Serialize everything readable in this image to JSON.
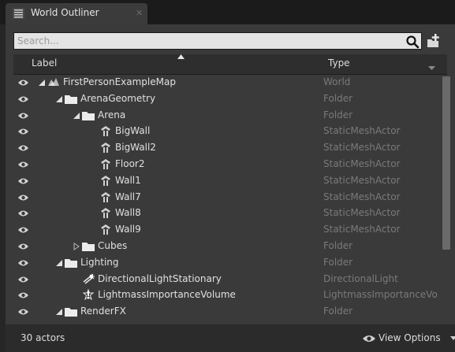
{
  "window": {
    "tab_title": "World Outliner"
  },
  "search": {
    "placeholder": "Search..."
  },
  "columns": {
    "label": "Label",
    "type": "Type"
  },
  "rows": [
    {
      "label": "FirstPersonExampleMap",
      "type": "World",
      "icon": "world-icon",
      "expander": "expanded",
      "indent": 0
    },
    {
      "label": "ArenaGeometry",
      "type": "Folder",
      "icon": "folder-icon",
      "expander": "expanded",
      "indent": 1
    },
    {
      "label": "Arena",
      "type": "Folder",
      "icon": "folder-icon",
      "expander": "expanded",
      "indent": 2
    },
    {
      "label": "BigWall",
      "type": "StaticMeshActor",
      "icon": "static-mesh-icon",
      "expander": "none",
      "indent": 3
    },
    {
      "label": "BigWall2",
      "type": "StaticMeshActor",
      "icon": "static-mesh-icon",
      "expander": "none",
      "indent": 3
    },
    {
      "label": "Floor2",
      "type": "StaticMeshActor",
      "icon": "static-mesh-icon",
      "expander": "none",
      "indent": 3
    },
    {
      "label": "Wall1",
      "type": "StaticMeshActor",
      "icon": "static-mesh-icon",
      "expander": "none",
      "indent": 3
    },
    {
      "label": "Wall7",
      "type": "StaticMeshActor",
      "icon": "static-mesh-icon",
      "expander": "none",
      "indent": 3
    },
    {
      "label": "Wall8",
      "type": "StaticMeshActor",
      "icon": "static-mesh-icon",
      "expander": "none",
      "indent": 3
    },
    {
      "label": "Wall9",
      "type": "StaticMeshActor",
      "icon": "static-mesh-icon",
      "expander": "none",
      "indent": 3
    },
    {
      "label": "Cubes",
      "type": "Folder",
      "icon": "folder-icon",
      "expander": "collapsed",
      "indent": 2
    },
    {
      "label": "Lighting",
      "type": "Folder",
      "icon": "folder-icon",
      "expander": "expanded",
      "indent": 1
    },
    {
      "label": "DirectionalLightStationary",
      "type": "DirectionalLight",
      "icon": "directional-light-icon",
      "expander": "none",
      "indent": 2
    },
    {
      "label": "LightmassImportanceVolume",
      "type": "LightmassImportanceVo",
      "icon": "lightmass-volume-icon",
      "expander": "none",
      "indent": 2
    },
    {
      "label": "RenderFX",
      "type": "Folder",
      "icon": "folder-icon",
      "expander": "expanded",
      "indent": 1
    }
  ],
  "footer": {
    "actor_count": "30 actors",
    "view_options_label": "View Options"
  },
  "scrollbar": {
    "visible_fraction": 0.71
  },
  "colors": {
    "panel_bg": "#3a3a3a",
    "label_text": "#e0e0e0",
    "type_text": "#7a7a7a",
    "folder": "#e8e8e8"
  }
}
